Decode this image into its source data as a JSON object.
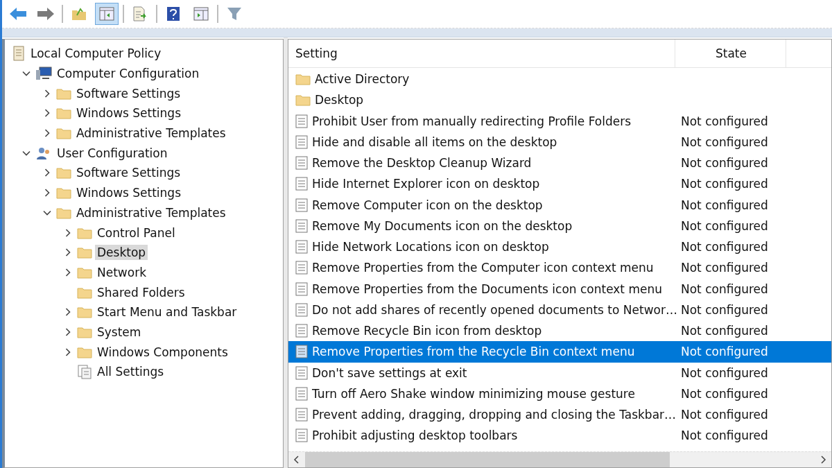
{
  "toolbar": [
    {
      "kind": "back",
      "pressed": false
    },
    {
      "kind": "forward",
      "pressed": false
    },
    {
      "kind": "separator"
    },
    {
      "kind": "up",
      "pressed": false
    },
    {
      "kind": "tree-pane",
      "pressed": true
    },
    {
      "kind": "separator"
    },
    {
      "kind": "export",
      "pressed": false
    },
    {
      "kind": "separator"
    },
    {
      "kind": "help",
      "pressed": false
    },
    {
      "kind": "action-pane",
      "pressed": false
    },
    {
      "kind": "separator"
    },
    {
      "kind": "filter",
      "pressed": false
    }
  ],
  "tree": [
    {
      "label": "Local Computer Policy",
      "kind": "policy",
      "selected": false,
      "children": [
        {
          "label": "Computer Configuration",
          "kind": "computer",
          "expandable": true,
          "expanded": true,
          "selected": false,
          "children": [
            {
              "label": "Software Settings",
              "kind": "folder",
              "expandable": true,
              "expanded": false,
              "selected": false
            },
            {
              "label": "Windows Settings",
              "kind": "folder",
              "expandable": true,
              "expanded": false,
              "selected": false
            },
            {
              "label": "Administrative Templates",
              "kind": "folder",
              "expandable": true,
              "expanded": false,
              "selected": false
            }
          ]
        },
        {
          "label": "User Configuration",
          "kind": "user",
          "expandable": true,
          "expanded": true,
          "selected": false,
          "children": [
            {
              "label": "Software Settings",
              "kind": "folder",
              "expandable": true,
              "expanded": false,
              "selected": false
            },
            {
              "label": "Windows Settings",
              "kind": "folder",
              "expandable": true,
              "expanded": false,
              "selected": false
            },
            {
              "label": "Administrative Templates",
              "kind": "folder",
              "expandable": true,
              "expanded": true,
              "selected": false,
              "children": [
                {
                  "label": "Control Panel",
                  "kind": "folder",
                  "expandable": true,
                  "expanded": false,
                  "selected": false
                },
                {
                  "label": "Desktop",
                  "kind": "folder",
                  "expandable": true,
                  "expanded": false,
                  "selected": true
                },
                {
                  "label": "Network",
                  "kind": "folder",
                  "expandable": true,
                  "expanded": false,
                  "selected": false
                },
                {
                  "label": "Shared Folders",
                  "kind": "folder",
                  "expandable": false,
                  "expanded": false,
                  "selected": false
                },
                {
                  "label": "Start Menu and Taskbar",
                  "kind": "folder",
                  "expandable": true,
                  "expanded": false,
                  "selected": false
                },
                {
                  "label": "System",
                  "kind": "folder",
                  "expandable": true,
                  "expanded": false,
                  "selected": false
                },
                {
                  "label": "Windows Components",
                  "kind": "folder",
                  "expandable": true,
                  "expanded": false,
                  "selected": false
                },
                {
                  "label": "All Settings",
                  "kind": "settings",
                  "expandable": false,
                  "expanded": false,
                  "selected": false
                }
              ]
            }
          ]
        }
      ]
    }
  ],
  "columns": [
    "Setting",
    "State"
  ],
  "rows": [
    {
      "kind": "folder",
      "setting": "Active Directory",
      "selected": false
    },
    {
      "kind": "folder",
      "setting": "Desktop",
      "selected": false
    },
    {
      "kind": "policy",
      "setting": "Prohibit User from manually redirecting Profile Folders",
      "state": "Not configured",
      "selected": false
    },
    {
      "kind": "policy",
      "setting": "Hide and disable all items on the desktop",
      "state": "Not configured",
      "selected": false
    },
    {
      "kind": "policy",
      "setting": "Remove the Desktop Cleanup Wizard",
      "state": "Not configured",
      "selected": false
    },
    {
      "kind": "policy",
      "setting": "Hide Internet Explorer icon on desktop",
      "state": "Not configured",
      "selected": false
    },
    {
      "kind": "policy",
      "setting": "Remove Computer icon on the desktop",
      "state": "Not configured",
      "selected": false
    },
    {
      "kind": "policy",
      "setting": "Remove My Documents icon on the desktop",
      "state": "Not configured",
      "selected": false
    },
    {
      "kind": "policy",
      "setting": "Hide Network Locations icon on desktop",
      "state": "Not configured",
      "selected": false
    },
    {
      "kind": "policy",
      "setting": "Remove Properties from the Computer icon context menu",
      "state": "Not configured",
      "selected": false
    },
    {
      "kind": "policy",
      "setting": "Remove Properties from the Documents icon context menu",
      "state": "Not configured",
      "selected": false
    },
    {
      "kind": "policy",
      "setting": "Do not add shares of recently opened documents to Networ…",
      "state": "Not configured",
      "selected": false
    },
    {
      "kind": "policy",
      "setting": "Remove Recycle Bin icon from desktop",
      "state": "Not configured",
      "selected": false
    },
    {
      "kind": "policy",
      "setting": "Remove Properties from the Recycle Bin context menu",
      "state": "Not configured",
      "selected": true
    },
    {
      "kind": "policy",
      "setting": "Don't save settings at exit",
      "state": "Not configured",
      "selected": false
    },
    {
      "kind": "policy",
      "setting": "Turn off Aero Shake window minimizing mouse gesture",
      "state": "Not configured",
      "selected": false
    },
    {
      "kind": "policy",
      "setting": "Prevent adding, dragging, dropping and closing the Taskbar…",
      "state": "Not configured",
      "selected": false
    },
    {
      "kind": "policy",
      "setting": "Prohibit adjusting desktop toolbars",
      "state": "Not configured",
      "selected": false
    }
  ]
}
